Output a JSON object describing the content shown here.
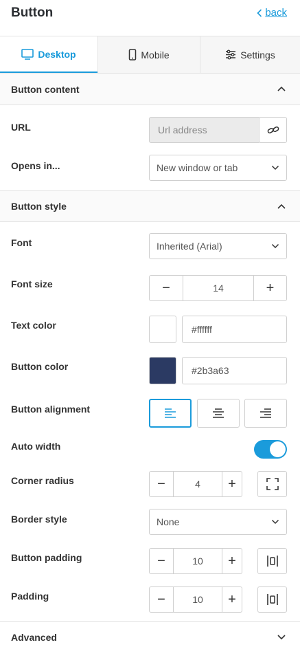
{
  "header": {
    "title": "Button",
    "back_label": "back"
  },
  "tabs": [
    {
      "label": "Desktop",
      "icon": "desktop-icon",
      "active": true
    },
    {
      "label": "Mobile",
      "icon": "mobile-icon",
      "active": false
    },
    {
      "label": "Settings",
      "icon": "sliders-icon",
      "active": false
    }
  ],
  "sections": {
    "content": {
      "title": "Button content"
    },
    "style": {
      "title": "Button style"
    },
    "advanced": {
      "title": "Advanced"
    }
  },
  "fields": {
    "url": {
      "label": "URL",
      "placeholder": "Url address"
    },
    "opens_in": {
      "label": "Opens in...",
      "value": "New window or tab"
    },
    "font": {
      "label": "Font",
      "value": "Inherited (Arial)"
    },
    "font_size": {
      "label": "Font size",
      "value": "14"
    },
    "text_color": {
      "label": "Text color",
      "value": "#ffffff"
    },
    "button_color": {
      "label": "Button color",
      "value": "#2b3a63"
    },
    "alignment": {
      "label": "Button alignment",
      "selected": "left"
    },
    "auto_width": {
      "label": "Auto width",
      "on": true
    },
    "corner_radius": {
      "label": "Corner radius",
      "value": "4"
    },
    "border_style": {
      "label": "Border style",
      "value": "None"
    },
    "button_padding": {
      "label": "Button padding",
      "value": "10"
    },
    "padding": {
      "label": "Padding",
      "value": "10"
    }
  },
  "colors": {
    "accent": "#1a9bdb",
    "text_swatch": "#ffffff",
    "button_swatch": "#2b3a63"
  }
}
